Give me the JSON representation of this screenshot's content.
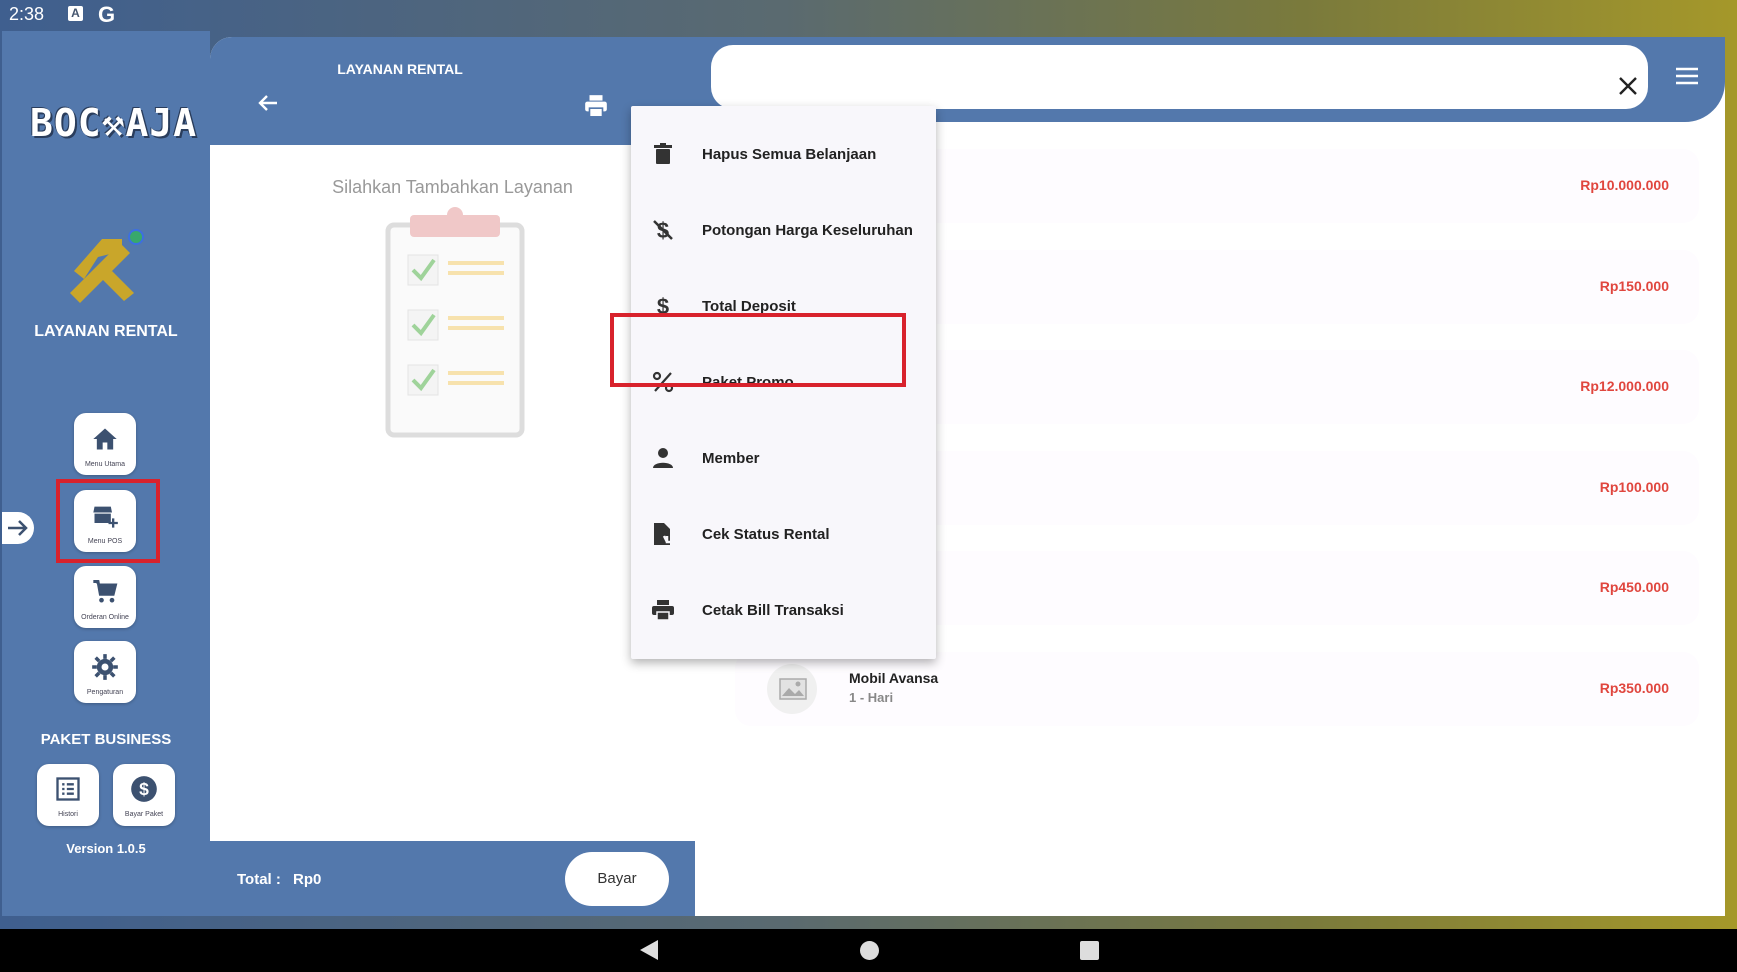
{
  "status_bar": {
    "time": "2:38",
    "notif_a": "A",
    "notif_g": "G"
  },
  "sidebar": {
    "logo_text": "BOC⚒AJA",
    "title": "LAYANAN RENTAL",
    "menu": [
      {
        "label": "Menu Utama",
        "icon": "home-icon"
      },
      {
        "label": "Menu POS",
        "icon": "store-add-icon"
      },
      {
        "label": "Orderan Online",
        "icon": "cart-icon"
      },
      {
        "label": "Pengaturan",
        "icon": "gear-icon"
      }
    ],
    "section_title": "PAKET BUSINESS",
    "business_buttons": [
      {
        "label": "Histori",
        "icon": "list-icon"
      },
      {
        "label": "Bayar Paket",
        "icon": "dollar-circle-icon"
      }
    ],
    "version": "Version 1.0.5"
  },
  "cart": {
    "title": "LAYANAN RENTAL",
    "empty_message": "Silahkan Tambahkan Layanan",
    "total_label": "Total :",
    "total_value": "Rp0",
    "pay_button": "Bayar"
  },
  "products": [
    {
      "name": "",
      "duration": "",
      "price": "Rp10.000.000"
    },
    {
      "name": "",
      "duration": "",
      "price": "Rp150.000"
    },
    {
      "name": "",
      "duration": "",
      "price": "Rp12.000.000"
    },
    {
      "name": "",
      "duration": "",
      "price": "Rp100.000"
    },
    {
      "name": "",
      "duration": "",
      "price": "Rp450.000"
    },
    {
      "name": "Mobil Avansa",
      "duration": "1 - Hari",
      "price": "Rp350.000"
    }
  ],
  "dropdown": {
    "items": [
      {
        "label": "Hapus Semua Belanjaan",
        "icon": "trash-icon"
      },
      {
        "label": "Potongan Harga Keseluruhan",
        "icon": "no-money-icon"
      },
      {
        "label": "Total Deposit",
        "icon": "dollar-icon"
      },
      {
        "label": "Paket Promo",
        "icon": "percent-icon"
      },
      {
        "label": "Member",
        "icon": "person-icon"
      },
      {
        "label": "Cek Status Rental",
        "icon": "file-check-icon"
      },
      {
        "label": "Cetak Bill Transaksi",
        "icon": "printer-icon"
      }
    ],
    "highlighted": "Paket Promo"
  },
  "colors": {
    "primary": "#5378ac",
    "price": "#e0463e",
    "highlight": "#d8222c"
  }
}
